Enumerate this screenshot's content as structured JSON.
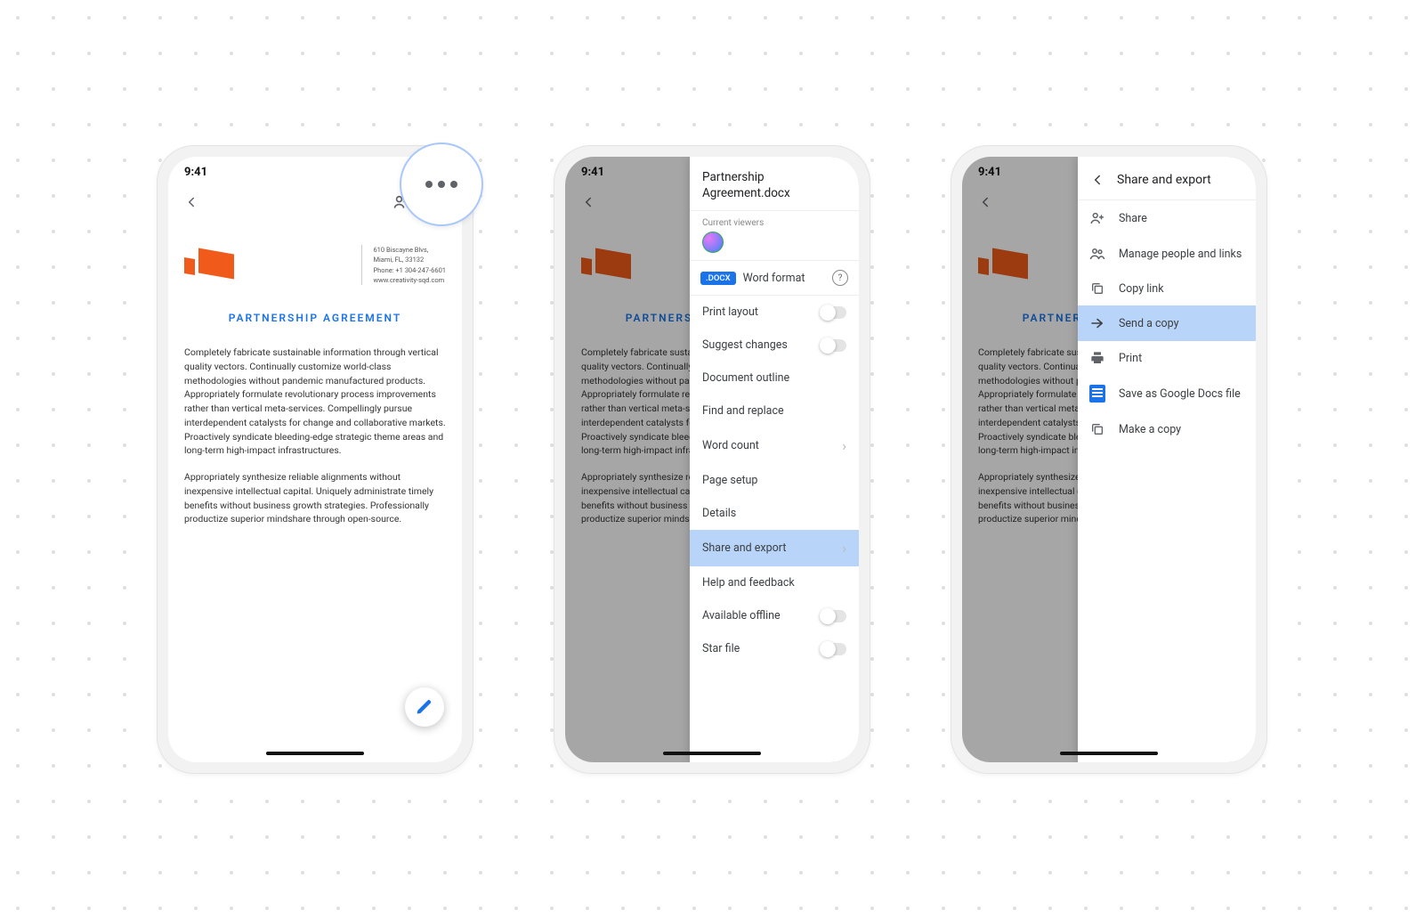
{
  "status": {
    "time": "9:41"
  },
  "doc": {
    "title": "PARTNERSHIP AGREEMENT",
    "contact_l1": "610 Biscayne Blvs,",
    "contact_l2": "Miami, FL, 33132",
    "contact_l3": "Phone: +1 304-247-6601",
    "contact_l4": "www.creativity-sqd.com",
    "para1": "Completely fabricate sustainable information through vertical quality vectors. Continually customize world-class methodologies without pandemic manufactured products. Appropriately formulate revolutionary process improvements rather than vertical meta-services. Compellingly pursue interdependent catalysts for change and collaborative markets. Proactively syndicate bleeding-edge strategic theme areas and long-term high-impact infrastructures.",
    "para2": "Appropriately synthesize reliable alignments without inexpensive intellectual capital. Uniquely administrate timely benefits without business growth strategies. Professionally productize superior mindshare through open-source."
  },
  "moreMenu": {
    "filename": "Partnership Agreement.docx",
    "viewersLabel": "Current viewers",
    "badge": ".DOCX",
    "formatText": "Word format",
    "items": {
      "printLayout": "Print layout",
      "suggest": "Suggest changes",
      "outline": "Document outline",
      "find": "Find and replace",
      "wordCount": "Word count",
      "pageSetup": "Page setup",
      "details": "Details",
      "shareExport": "Share and export",
      "help": "Help and feedback",
      "offline": "Available offline",
      "star": "Star file"
    }
  },
  "shareMenu": {
    "title": "Share and export",
    "items": {
      "share": "Share",
      "manage": "Manage people and links",
      "copyLink": "Copy link",
      "sendCopy": "Send a copy",
      "print": "Print",
      "saveAs": "Save as Google Docs file",
      "makeCopy": "Make a copy"
    }
  }
}
